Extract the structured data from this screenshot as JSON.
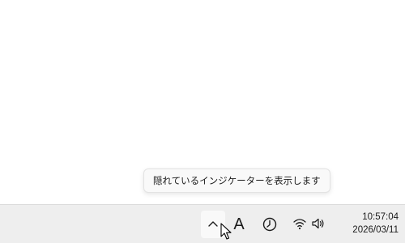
{
  "tooltip": {
    "text": "隠れているインジケーターを表示します"
  },
  "taskbar": {
    "tray": {
      "chevron_icon": "chevron-up-icon",
      "ime_label": "A",
      "focus_icon": "moon-clock-icon",
      "network_icon": "wifi-icon",
      "volume_icon": "speaker-icon"
    },
    "clock": {
      "time": "10:57:04",
      "date": "2026/03/11"
    }
  },
  "colors": {
    "taskbar_bg": "#eeeeee",
    "tooltip_bg": "#f9f9f9",
    "text": "#1b1b1b"
  }
}
